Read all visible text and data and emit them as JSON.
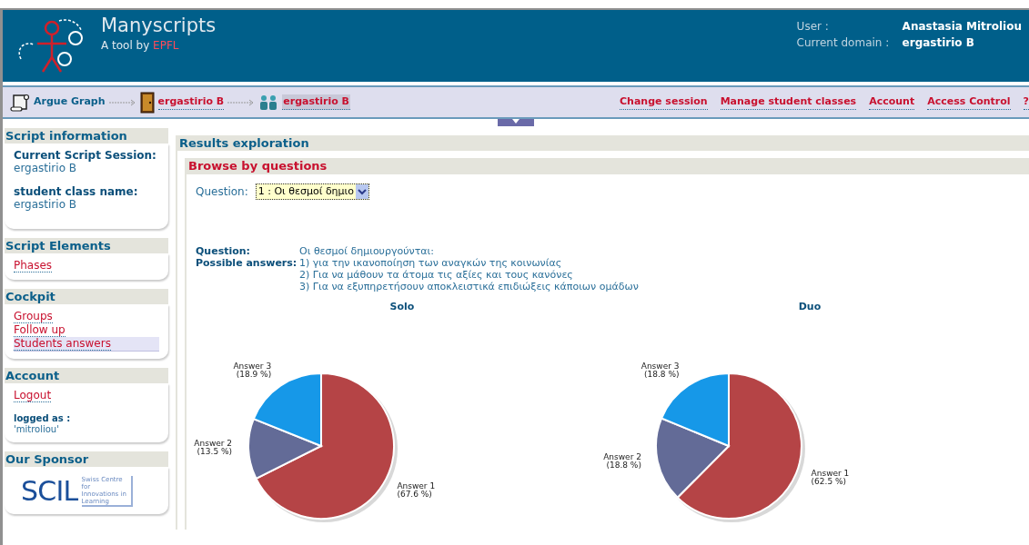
{
  "header": {
    "app_name": "Manyscripts",
    "tagline": "A tool by ",
    "tagline_org": "EPFL",
    "user_label": "User :",
    "user_value": "Anastasia Mitroliou",
    "domain_label": "Current domain :",
    "domain_value": "ergastirio B"
  },
  "breadcrumb": [
    {
      "kind": "script",
      "label": "Argue Graph",
      "selected": false
    },
    {
      "kind": "domain",
      "label": "ergastirio B",
      "selected": false
    },
    {
      "kind": "class",
      "label": "ergastirio B",
      "selected": true
    }
  ],
  "nav_links": [
    "Change session",
    "Manage student classes",
    "Account",
    "Access Control",
    "?"
  ],
  "sidebar": [
    {
      "title": "Script information",
      "items": [
        {
          "kind": "info",
          "label": "Current Script Session:",
          "value": "ergastirio B"
        },
        {
          "kind": "info",
          "label": "student class name:",
          "value": "ergastirio B"
        }
      ]
    },
    {
      "title": "Script Elements",
      "items": [
        {
          "kind": "link",
          "label": "Phases",
          "selected": false
        }
      ]
    },
    {
      "title": "Cockpit",
      "items": [
        {
          "kind": "link",
          "label": "Groups",
          "selected": false
        },
        {
          "kind": "link",
          "label": "Follow up",
          "selected": false
        },
        {
          "kind": "link",
          "label": "Students answers",
          "selected": true
        }
      ]
    },
    {
      "title": "Account",
      "items": [
        {
          "kind": "link",
          "label": "Logout",
          "selected": false
        },
        {
          "kind": "small",
          "label": "logged as :",
          "value": "'mitroliou'"
        }
      ]
    },
    {
      "title": "Our Sponsor",
      "items": [
        {
          "kind": "sponsor",
          "label": "SCIL",
          "value": "Swiss Centre for Innovations in Learning"
        }
      ]
    }
  ],
  "main": {
    "title": "Results exploration",
    "section_title": "Browse by questions",
    "question_select": {
      "label": "Question:",
      "value": "1 : Οι θεσμοί δημιο"
    },
    "question_label": "Question:",
    "question_text": "Οι θεσμοί δημιουργούνται:",
    "answers_label": "Possible answers:",
    "answers": [
      "1) για την ικανοποίηση των αναγκών της κοινωνίας",
      "2) Για να μάθουν τα άτομα τις αξίες και τους κανόνες",
      "3) Για να εξυπηρετήσουν αποκλειστικά επιδιώξεις κάποιων ομάδων"
    ],
    "charts": [
      {
        "chart_data": {
          "type": "pie",
          "title": "Solo",
          "categories": [
            "Answer 1",
            "Answer 2",
            "Answer 3"
          ],
          "values": [
            67.6,
            13.5,
            18.9
          ],
          "value_labels": [
            "(67.6 %)",
            "(13.5 %)",
            "(18.9 %)"
          ]
        }
      },
      {
        "chart_data": {
          "type": "pie",
          "title": "Duo",
          "categories": [
            "Answer 1",
            "Answer 2",
            "Answer 3"
          ],
          "values": [
            62.5,
            18.8,
            18.8
          ],
          "value_labels": [
            "(62.5 %)",
            "(18.8 %)",
            "(18.8 %)"
          ]
        }
      }
    ]
  }
}
